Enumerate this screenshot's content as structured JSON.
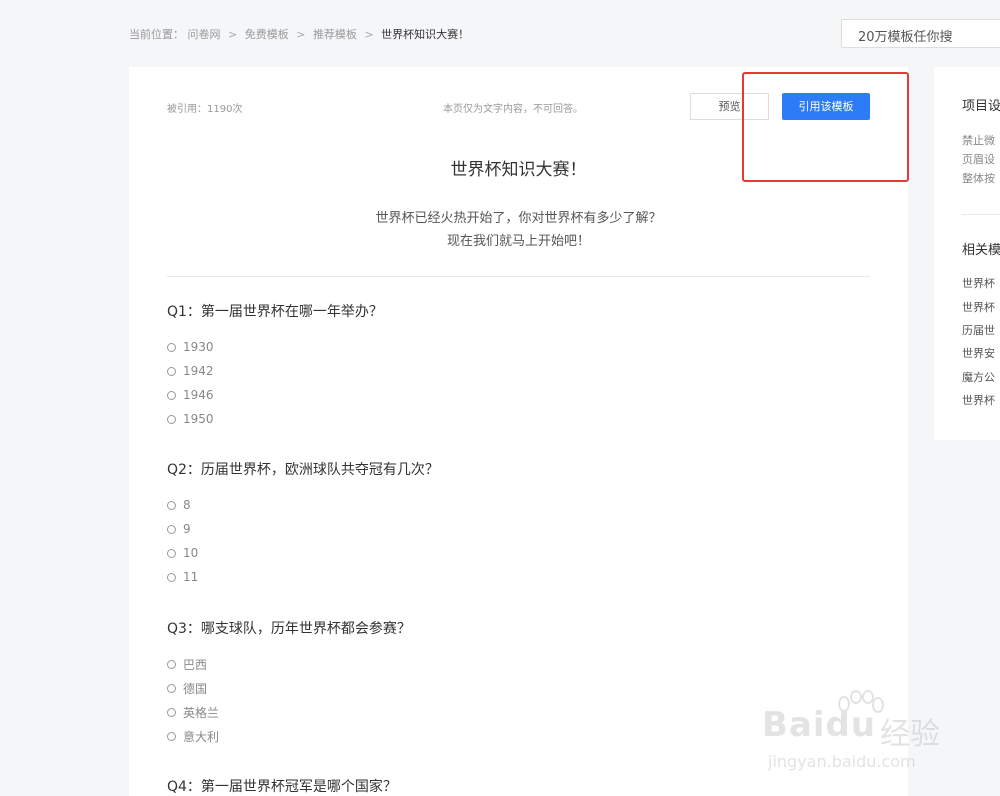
{
  "breadcrumb": {
    "prefix": "当前位置：",
    "items": [
      "问卷网",
      "免费模板",
      "推荐模板"
    ],
    "current": "世界杯知识大赛！",
    "separator": ">"
  },
  "search": {
    "placeholder": "20万模板任你搜"
  },
  "header": {
    "cite_count": "被引用：1190次",
    "readonly_note": "本页仅为文字内容，不可回答。",
    "preview_label": "预览",
    "use_label": "引用该模板"
  },
  "survey": {
    "title": "世界杯知识大赛！",
    "desc_line1": "世界杯已经火热开始了，你对世界杯有多少了解？",
    "desc_line2": "现在我们就马上开始吧！",
    "questions": [
      {
        "title": "Q1：第一届世界杯在哪一年举办？",
        "options": [
          "1930",
          "1942",
          "1946",
          "1950"
        ]
      },
      {
        "title": "Q2：历届世界杯，欧洲球队共夺冠有几次？",
        "options": [
          "8",
          "9",
          "10",
          "11"
        ]
      },
      {
        "title": "Q3：哪支球队，历年世界杯都会参赛？",
        "options": [
          "巴西",
          "德国",
          "英格兰",
          "意大利"
        ]
      },
      {
        "title": "Q4：第一届世界杯冠军是哪个国家？",
        "options": []
      }
    ]
  },
  "sidebar": {
    "settings_heading": "项目设",
    "settings_items": [
      "禁止微",
      "页眉设",
      "整体按"
    ],
    "related_heading": "相关模",
    "related_items": [
      "世界杯",
      "世界杯",
      "历届世",
      "世界安",
      "魔方公",
      "世界杯"
    ]
  },
  "watermark": {
    "brand": "Baidu",
    "cn": "经验",
    "url": "jingyan.baidu.com"
  },
  "colors": {
    "primary": "#2b7cf6",
    "highlight": "#e53935",
    "background": "#f5f6f8"
  }
}
